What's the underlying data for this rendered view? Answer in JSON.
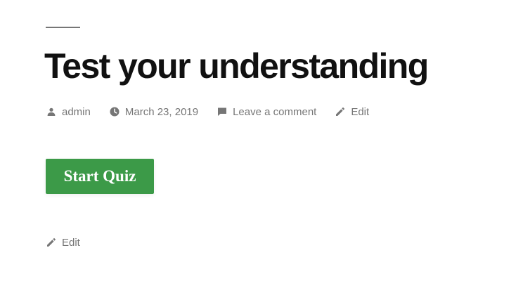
{
  "post": {
    "title": "Test your understanding",
    "meta": {
      "author": "admin",
      "author_icon": "person-icon",
      "date": "March 23, 2019",
      "date_icon": "clock-icon",
      "comments": "Leave a comment",
      "comments_icon": "comment-icon",
      "edit": "Edit",
      "edit_icon": "pencil-icon"
    }
  },
  "quiz": {
    "start_label": "Start Quiz",
    "button_color": "#3c9a48"
  },
  "footer": {
    "edit_label": "Edit",
    "edit_icon": "pencil-icon"
  },
  "colors": {
    "title": "#111111",
    "meta_text": "#767676",
    "rule": "#767676"
  }
}
